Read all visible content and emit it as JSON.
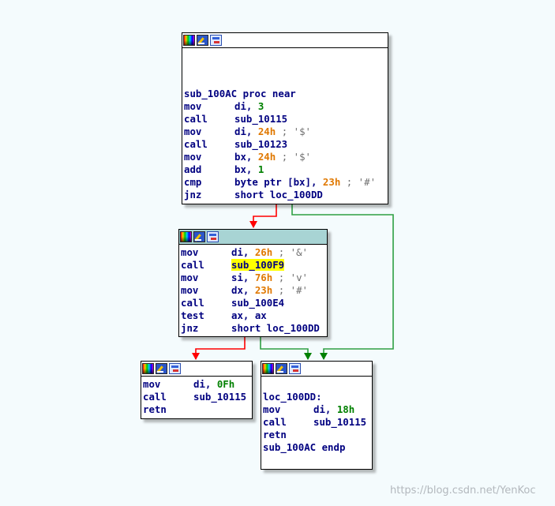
{
  "colors": {
    "background": "#f4fbfd",
    "edge_false": "#ff0000",
    "edge_true": "#008000",
    "selected_header": "#a8d4d4",
    "highlight": "#ffff00"
  },
  "header_icons": [
    "color-palette-icon",
    "rename-pencil-icon",
    "graph-view-icon"
  ],
  "nodes": {
    "entry": {
      "lines": [
        {
          "label": "sub_100AC proc near"
        },
        {
          "mn": "mov",
          "a": "di, ",
          "num": "3",
          "numclass": "imm"
        },
        {
          "mn": "call",
          "a": "sub_10115"
        },
        {
          "mn": "mov",
          "a": "di, ",
          "num": "24h",
          "numclass": "num",
          "cmt": " ; '$'"
        },
        {
          "mn": "call",
          "a": "sub_10123"
        },
        {
          "mn": "mov",
          "a": "bx, ",
          "num": "24h",
          "numclass": "num",
          "cmt": " ; '$'"
        },
        {
          "mn": "add",
          "a": "bx, ",
          "num": "1",
          "numclass": "imm"
        },
        {
          "mn": "cmp",
          "a": "byte ptr [bx], ",
          "num": "23h",
          "numclass": "num",
          "cmt": " ; '#'"
        },
        {
          "mn": "jnz",
          "a": "short loc_100DD"
        }
      ]
    },
    "middle": {
      "lines": [
        {
          "mn": "mov",
          "a": "di, ",
          "num": "26h",
          "numclass": "num",
          "cmt": " ; '&'"
        },
        {
          "mn": "call",
          "a": "sub_100F9",
          "highlight": true
        },
        {
          "mn": "mov",
          "a": "si, ",
          "num": "76h",
          "numclass": "num",
          "cmt": " ; 'v'"
        },
        {
          "mn": "mov",
          "a": "dx, ",
          "num": "23h",
          "numclass": "num",
          "cmt": " ; '#'"
        },
        {
          "mn": "call",
          "a": "sub_100E4"
        },
        {
          "mn": "test",
          "a": "ax, ax"
        },
        {
          "mn": "jnz",
          "a": "short loc_100DD"
        }
      ]
    },
    "left": {
      "lines": [
        {
          "mn": "mov",
          "a": "di, ",
          "num": "0Fh",
          "numclass": "imm"
        },
        {
          "mn": "call",
          "a": "sub_10115"
        },
        {
          "mn": "retn",
          "a": ""
        }
      ]
    },
    "right": {
      "lines": [
        {
          "label": "loc_100DD:"
        },
        {
          "mn": "mov",
          "a": "di, ",
          "num": "18h",
          "numclass": "imm"
        },
        {
          "mn": "call",
          "a": "sub_10115"
        },
        {
          "mn": "retn",
          "a": ""
        },
        {
          "label": "sub_100AC endp"
        }
      ]
    }
  },
  "watermark": "https://blog.csdn.net/YenKoc"
}
